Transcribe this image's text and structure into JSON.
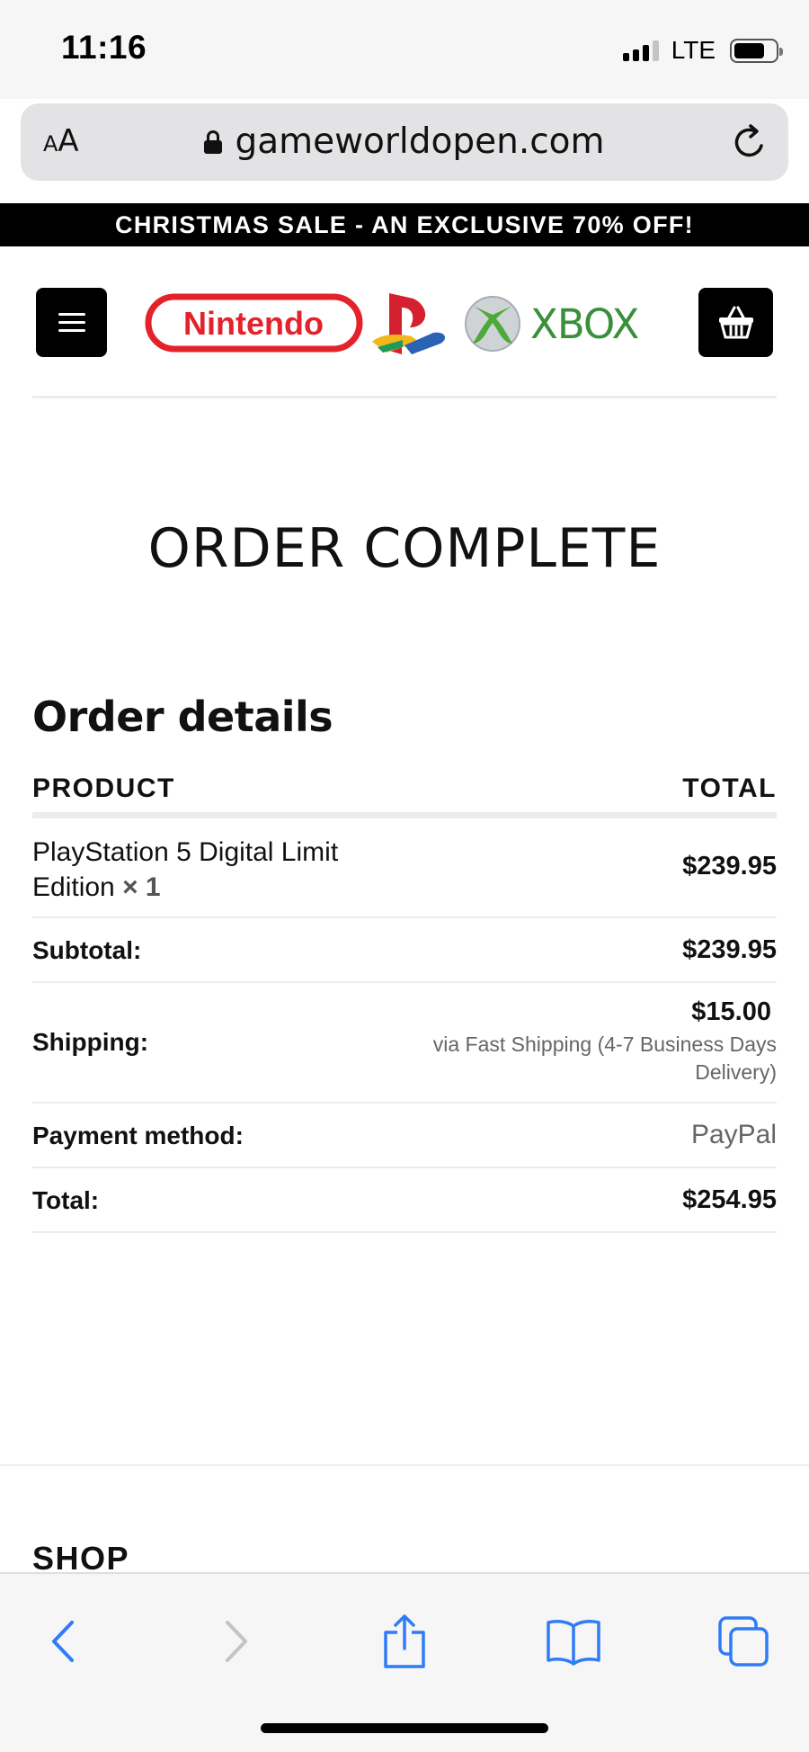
{
  "status_bar": {
    "time": "11:16",
    "network": "LTE"
  },
  "browser": {
    "text_size_small": "A",
    "text_size_big": "A",
    "url": "gameworldopen.com",
    "icons": [
      "lock-icon",
      "reload-icon",
      "back-icon",
      "forward-icon",
      "share-icon",
      "bookmarks-icon",
      "tabs-icon"
    ],
    "accent_color": "#2f7cf6",
    "disabled_color": "#c4c4c8"
  },
  "banner": {
    "text": "CHRISTMAS SALE - AN EXCLUSIVE 70% OFF!"
  },
  "header": {
    "logos": {
      "nintendo": "Nintendo",
      "xbox": "XBOX"
    },
    "colors": {
      "nintendo_red": "#e4222b",
      "xbox_green": "#3a8f3a"
    }
  },
  "page": {
    "title": "ORDER COMPLETE",
    "section_title": "Order details"
  },
  "order": {
    "columns": {
      "product": "PRODUCT",
      "total": "TOTAL"
    },
    "item": {
      "name_line1": "PlayStation 5 Digital Limit",
      "name_line2": "Edition",
      "quantity": "× 1",
      "total": "$239.95"
    },
    "subtotal": {
      "label": "Subtotal:",
      "value": "$239.95"
    },
    "shipping": {
      "label": "Shipping:",
      "value": "$15.00",
      "method_line1": "via Fast Shipping (4-7 Business Days",
      "method_line2": "Delivery)"
    },
    "payment": {
      "label": "Payment method:",
      "value": "PayPal"
    },
    "total": {
      "label": "Total:",
      "value": "$254.95"
    }
  },
  "footer": {
    "shop_title": "SHOP"
  }
}
